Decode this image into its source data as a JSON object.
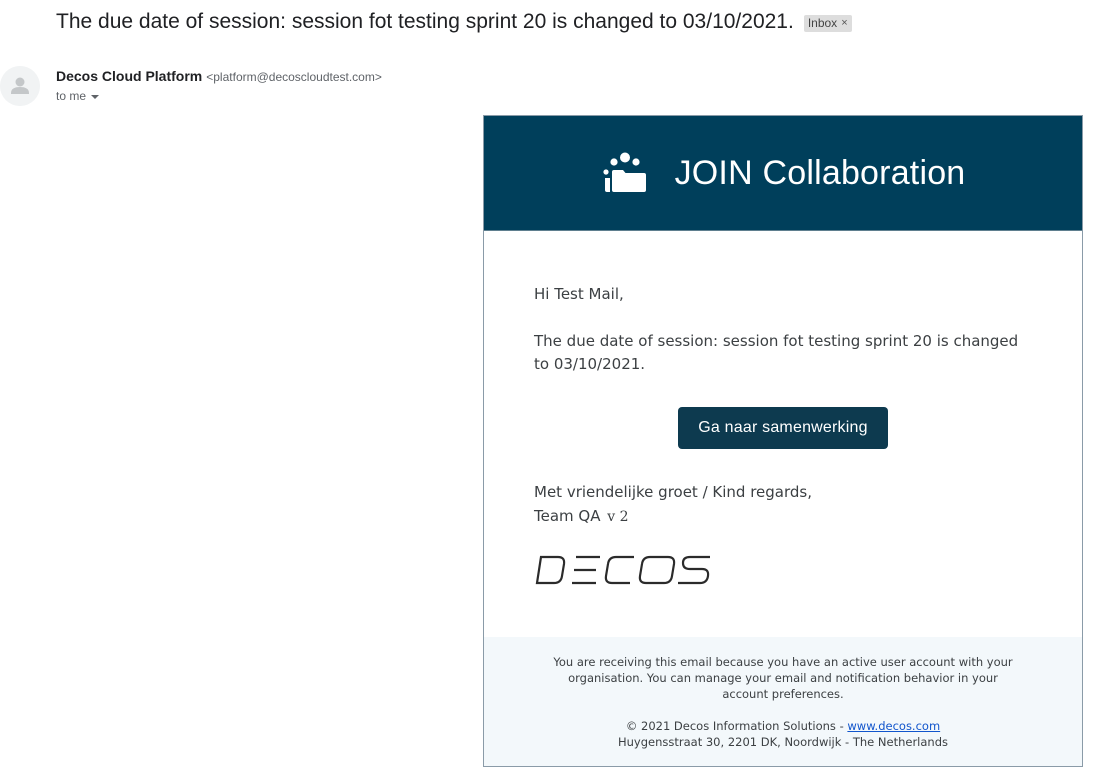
{
  "email": {
    "subject": "The due date of session: session fot testing sprint 20 is changed to 03/10/2021.",
    "label_chip": "Inbox",
    "label_chip_close": "×",
    "sender_name": "Decos Cloud Platform",
    "sender_email": "<platform@decoscloudtest.com>",
    "recipient": "to me"
  },
  "card": {
    "header_title": "JOIN Collaboration",
    "header_bg": "#003f5b",
    "greeting": "Hi Test Mail,",
    "message": "The due date of session: session fot testing sprint 20 is changed to 03/10/2021.",
    "cta_label": "Ga naar samenwerking",
    "regards": "Met vriendelijke groet / Kind regards,",
    "team_name": "Team QA",
    "team_version": "v 2",
    "logo_text": "DECOS"
  },
  "footer": {
    "note": "You are receiving this email because you have an active user account with your organisation. You can manage your email and notification behavior in your account preferences.",
    "copyright_prefix": "© 2021 Decos Information Solutions - ",
    "link_text": "www.decos.com",
    "address": "Huygensstraat 30, 2201 DK, Noordwijk - The Netherlands",
    "bg": "#f3f8fb"
  },
  "icons": {
    "avatar": "default-person-icon",
    "brand": "team-folder-icon",
    "caret": "chevron-down-icon"
  }
}
